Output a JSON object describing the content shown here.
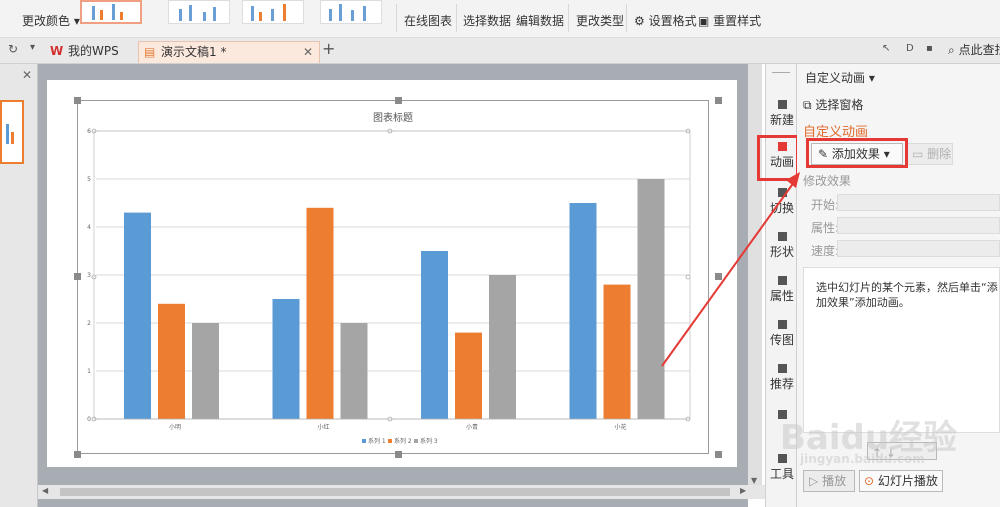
{
  "ribbon": {
    "change_color": "更改颜色",
    "online_chart": "在线图表",
    "select_data": "选择数据",
    "edit_data": "编辑数据",
    "change_type": "更改类型",
    "set_format": "设置格式",
    "reset_style": "重置样式"
  },
  "tabs": {
    "my_wps": "我的WPS",
    "doc": "演示文稿1 *",
    "search": "点此查找"
  },
  "rail": {
    "new": "新建",
    "animation": "动画",
    "switch": "切换",
    "shape": "形状",
    "property": "属性",
    "transfer": "传图",
    "recommend": "推荐",
    "tools": "工具"
  },
  "panel": {
    "title": "自定义动画",
    "select_pane": "选择窗格",
    "section": "自定义动画",
    "add_effect": "添加效果",
    "delete": "删除",
    "modify_effect": "修改效果",
    "start": "开始:",
    "property": "属性:",
    "speed": "速度:",
    "tip": "选中幻灯片的某个元素，然后单击“添加效果”添加动画。",
    "play": "播放",
    "slideshow": "幻灯片播放"
  },
  "chart_data": {
    "type": "bar",
    "title": "图表标题",
    "categories": [
      "小明",
      "小红",
      "小青",
      "小花"
    ],
    "series": [
      {
        "name": "系列 1",
        "values": [
          4.3,
          2.5,
          3.5,
          4.5
        ],
        "color": "#5b9bd5"
      },
      {
        "name": "系列 2",
        "values": [
          2.4,
          4.4,
          1.8,
          2.8
        ],
        "color": "#ed7d31"
      },
      {
        "name": "系列 3",
        "values": [
          2.0,
          2.0,
          3.0,
          5.0
        ],
        "color": "#a5a5a5"
      }
    ],
    "y_ticks": [
      "0",
      "1",
      "2",
      "3",
      "4",
      "5",
      "6"
    ],
    "ylim": [
      0,
      6
    ],
    "grid": true,
    "legend": "bottom"
  },
  "watermark": {
    "brand": "Baidu经验",
    "url": "jingyan.baidu.com"
  }
}
